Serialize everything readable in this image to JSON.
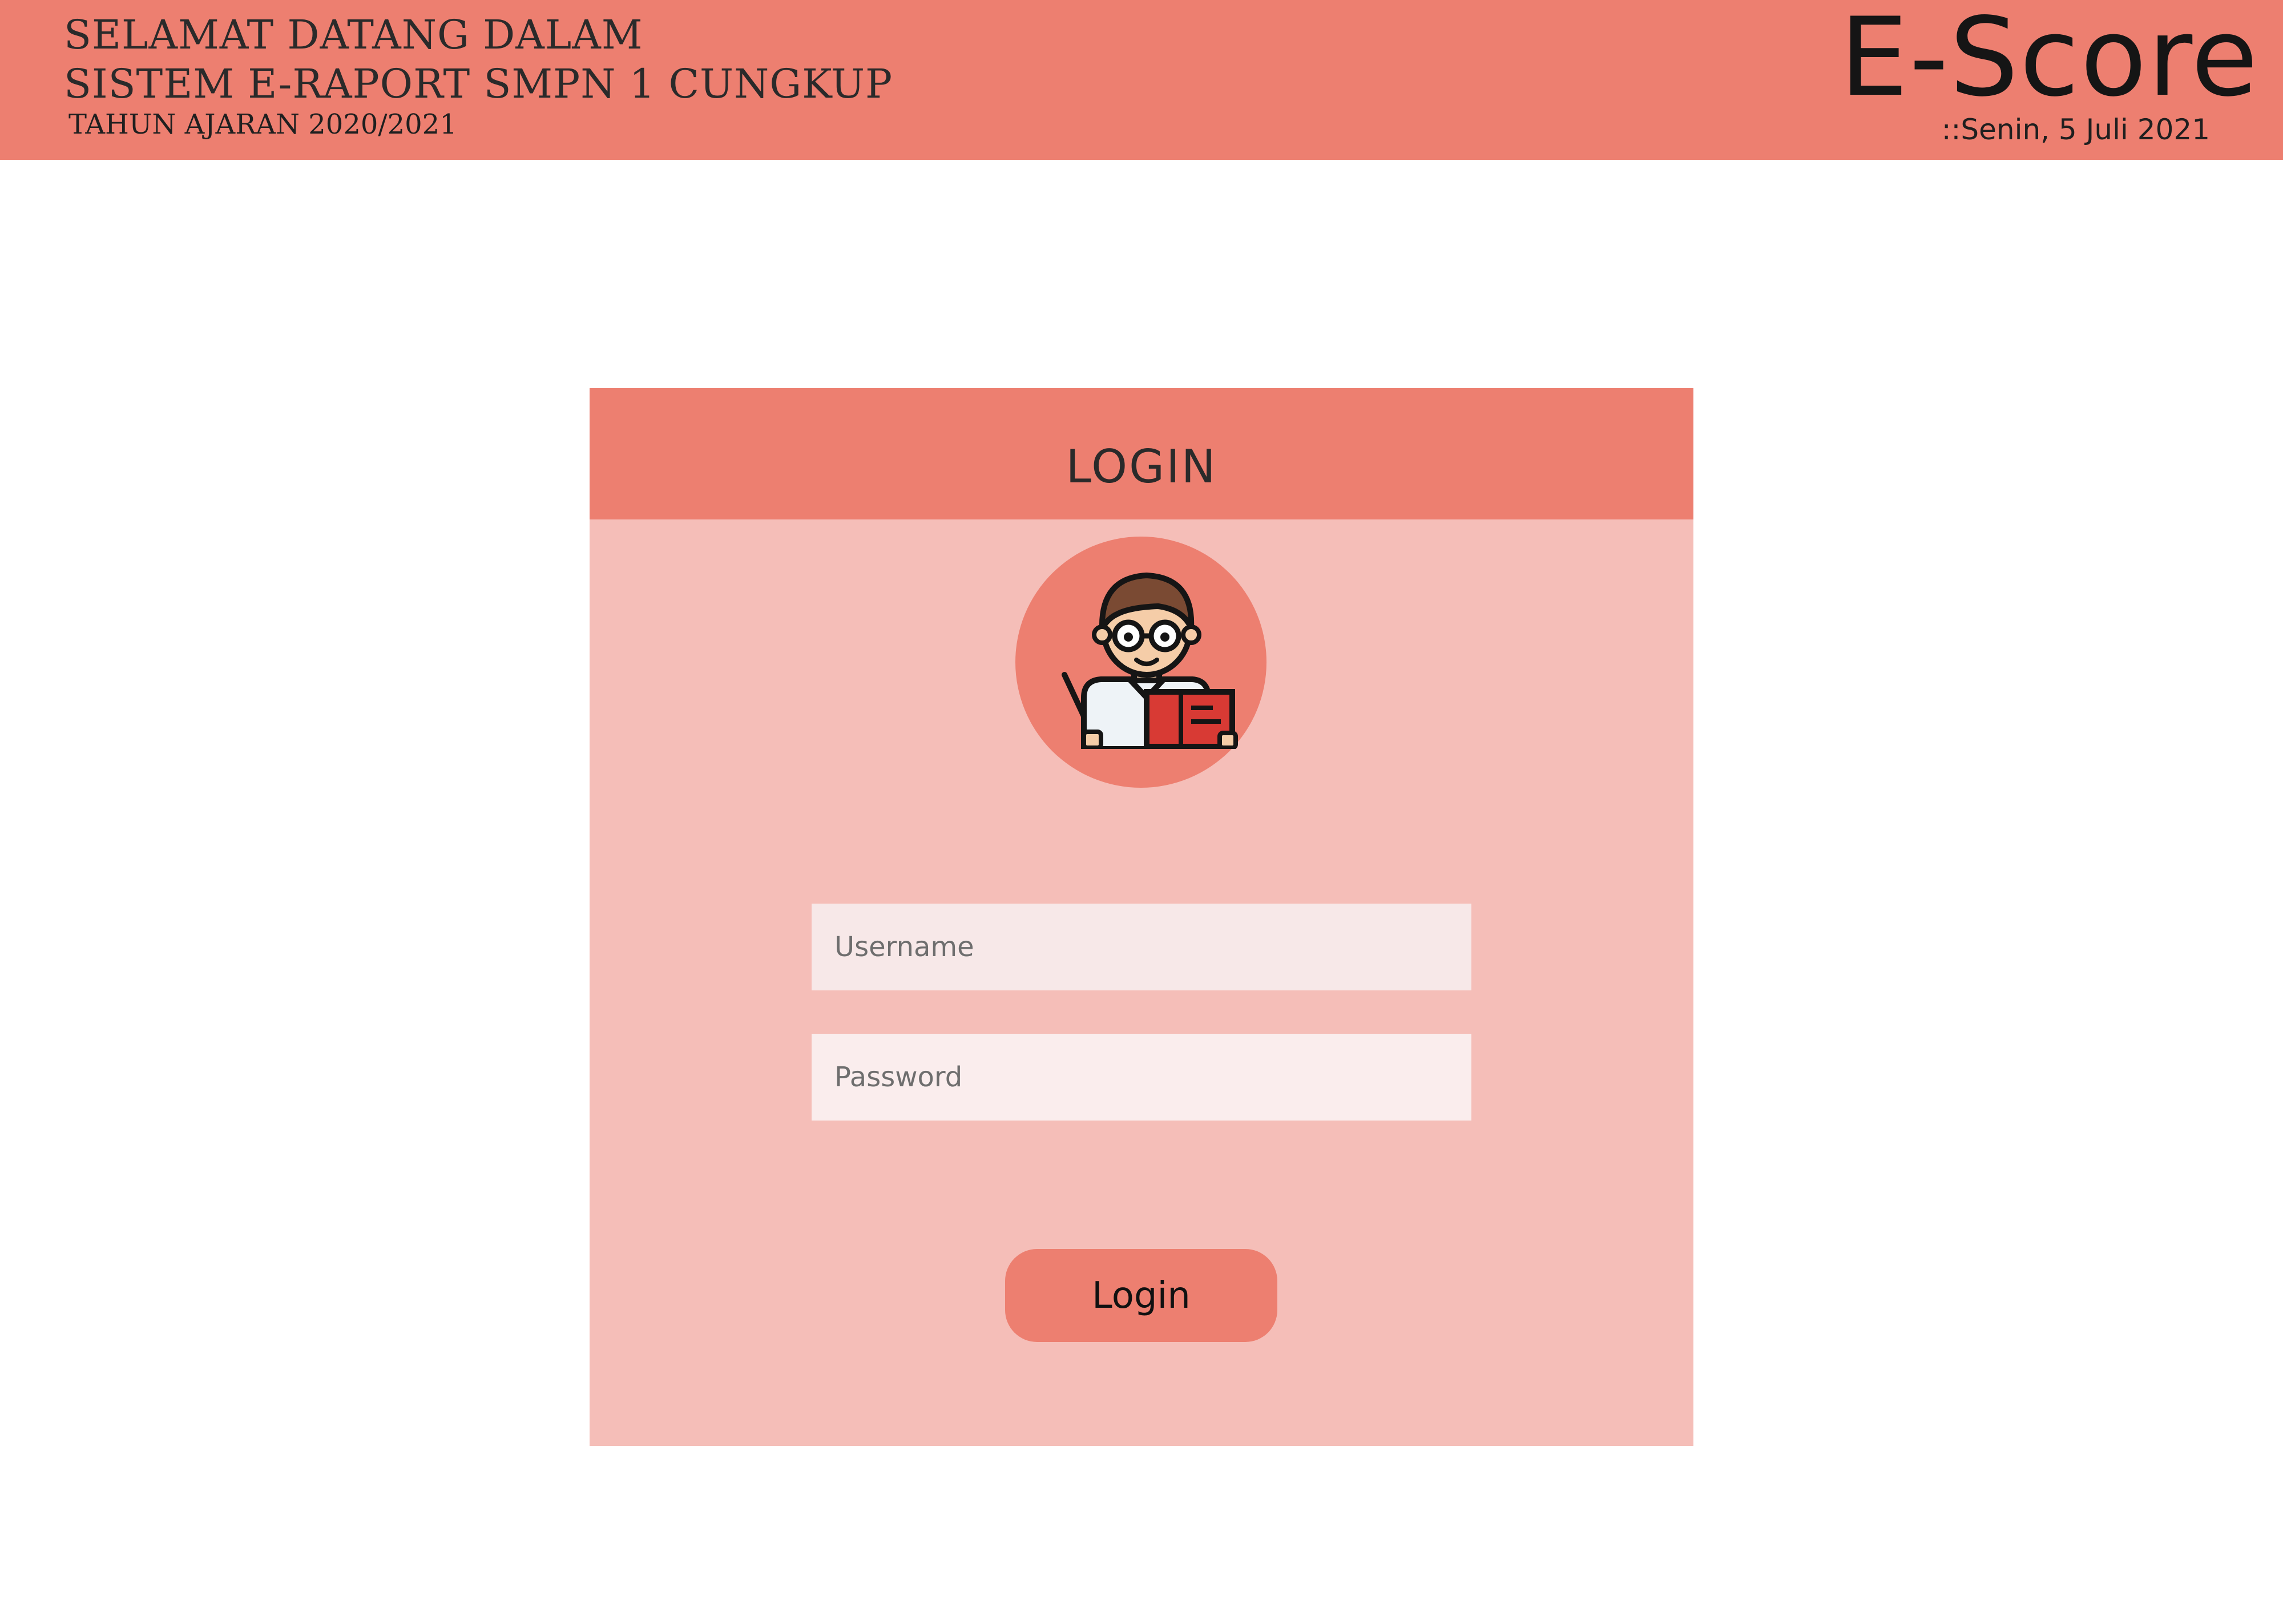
{
  "header": {
    "welcome_line_1": "SELAMAT DATANG DALAM",
    "welcome_line_2": "SISTEM E-RAPORT SMPN 1 CUNGKUP",
    "school_year": "TAHUN AJARAN  2020/2021",
    "brand": "E-Score",
    "date": "::Senin, 5 Juli 2021",
    "background_color": "#ed7f70"
  },
  "login": {
    "title": "LOGIN",
    "avatar_icon": "teacher-icon",
    "username": {
      "placeholder": "Username",
      "value": ""
    },
    "password": {
      "placeholder": "Password",
      "value": ""
    },
    "submit_label": "Login",
    "card_color": "#f5beb8",
    "accent_color": "#ed7f70"
  }
}
